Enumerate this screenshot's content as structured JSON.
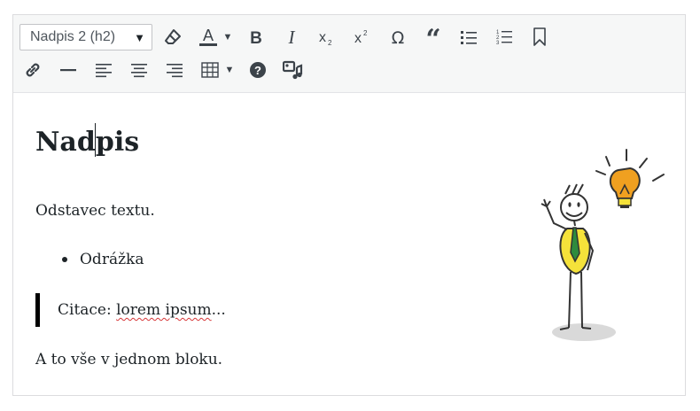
{
  "toolbar": {
    "format_select": "Nadpis 2 (h2)",
    "colors": {
      "text_color": "#1d2327",
      "icon": "#3c434a"
    }
  },
  "content": {
    "heading_before_caret": "Nad",
    "heading_after_caret": "pis",
    "paragraph": "Odstavec textu.",
    "bullet_item": "Odrážka",
    "quote_prefix": "Citace: ",
    "quote_misspelled": "lorem ipsum",
    "quote_suffix": "...",
    "last_paragraph": "A to vše v jednom bloku."
  },
  "icons": {
    "row1": [
      "eraser-icon",
      "text-color-icon",
      "bold-icon",
      "italic-icon",
      "subscript-icon",
      "superscript-icon",
      "omega-icon",
      "blockquote-icon",
      "bullet-list-icon",
      "numbered-list-icon",
      "bookmark-icon"
    ],
    "row2": [
      "link-icon",
      "horizontal-rule-icon",
      "align-left-icon",
      "align-center-icon",
      "align-right-icon",
      "table-icon",
      "help-icon",
      "media-icon"
    ]
  },
  "illustration": {
    "name": "stick-figure-lightbulb",
    "accent": "#f0a020",
    "shirt": "#f5e23a",
    "tie": "#2e8b3d"
  }
}
